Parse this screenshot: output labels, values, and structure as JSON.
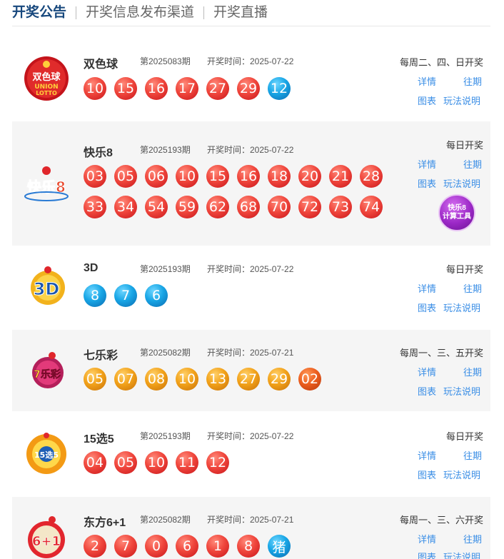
{
  "tabs": [
    "开奖公告",
    "开奖信息发布渠道",
    "开奖直播"
  ],
  "links": {
    "detail": "详情",
    "past": "往期",
    "chart": "图表",
    "howto": "玩法说明"
  },
  "colors": {
    "red": "#e83a32",
    "blue": "#1296db",
    "orange": "#f2a21a",
    "dark_orange": "#ec5e1f",
    "link": "#3a8ee6",
    "active_tab": "#17487d",
    "row_gray": "#f5f5f5"
  },
  "lotteries": [
    {
      "name": "双色球",
      "issue": "第2025083期",
      "date": "开奖时间：2025-07-22",
      "schedule": "每周二、四、日开奖",
      "logo_icon": "ssq-logo-icon",
      "logo_text": "双色球",
      "balls": [
        {
          "n": "10",
          "c": "red"
        },
        {
          "n": "15",
          "c": "red"
        },
        {
          "n": "16",
          "c": "red"
        },
        {
          "n": "17",
          "c": "red"
        },
        {
          "n": "27",
          "c": "red"
        },
        {
          "n": "29",
          "c": "red"
        },
        {
          "n": "12",
          "c": "blue"
        }
      ]
    },
    {
      "name": "快乐8",
      "issue": "第2025193期",
      "date": "开奖时间：2025-07-22",
      "schedule": "每日开奖",
      "logo_icon": "kl8-logo-icon",
      "logo_text": "快乐8",
      "tool_label": [
        "快乐8",
        "计算工具"
      ],
      "balls": [
        {
          "n": "03",
          "c": "red"
        },
        {
          "n": "05",
          "c": "red"
        },
        {
          "n": "06",
          "c": "red"
        },
        {
          "n": "10",
          "c": "red"
        },
        {
          "n": "15",
          "c": "red"
        },
        {
          "n": "16",
          "c": "red"
        },
        {
          "n": "18",
          "c": "red"
        },
        {
          "n": "20",
          "c": "red"
        },
        {
          "n": "21",
          "c": "red"
        },
        {
          "n": "28",
          "c": "red"
        },
        {
          "n": "33",
          "c": "red"
        },
        {
          "n": "34",
          "c": "red"
        },
        {
          "n": "54",
          "c": "red"
        },
        {
          "n": "59",
          "c": "red"
        },
        {
          "n": "62",
          "c": "red"
        },
        {
          "n": "68",
          "c": "red"
        },
        {
          "n": "70",
          "c": "red"
        },
        {
          "n": "72",
          "c": "red"
        },
        {
          "n": "73",
          "c": "red"
        },
        {
          "n": "74",
          "c": "red"
        }
      ]
    },
    {
      "name": "3D",
      "issue": "第2025193期",
      "date": "开奖时间：2025-07-22",
      "schedule": "每日开奖",
      "logo_icon": "3d-logo-icon",
      "logo_text": "3D",
      "balls": [
        {
          "n": "8",
          "c": "blue"
        },
        {
          "n": "7",
          "c": "blue"
        },
        {
          "n": "6",
          "c": "blue"
        }
      ]
    },
    {
      "name": "七乐彩",
      "issue": "第2025082期",
      "date": "开奖时间：2025-07-21",
      "schedule": "每周一、三、五开奖",
      "logo_icon": "qlc-logo-icon",
      "logo_text": "7乐彩",
      "balls": [
        {
          "n": "05",
          "c": "orange"
        },
        {
          "n": "07",
          "c": "orange"
        },
        {
          "n": "08",
          "c": "orange"
        },
        {
          "n": "10",
          "c": "orange"
        },
        {
          "n": "13",
          "c": "orange"
        },
        {
          "n": "27",
          "c": "orange"
        },
        {
          "n": "29",
          "c": "orange"
        },
        {
          "n": "02",
          "c": "dorange"
        }
      ]
    },
    {
      "name": "15选5",
      "issue": "第2025193期",
      "date": "开奖时间：2025-07-22",
      "schedule": "每日开奖",
      "logo_icon": "15x5-logo-icon",
      "logo_text": "15选5",
      "balls": [
        {
          "n": "04",
          "c": "red"
        },
        {
          "n": "05",
          "c": "red"
        },
        {
          "n": "10",
          "c": "red"
        },
        {
          "n": "11",
          "c": "red"
        },
        {
          "n": "12",
          "c": "red"
        }
      ]
    },
    {
      "name": "东方6+1",
      "issue": "第2025082期",
      "date": "开奖时间：2025-07-21",
      "schedule": "每周一、三、六开奖",
      "logo_icon": "df61-logo-icon",
      "logo_text": "6+1",
      "balls": [
        {
          "n": "2",
          "c": "red"
        },
        {
          "n": "7",
          "c": "red"
        },
        {
          "n": "0",
          "c": "red"
        },
        {
          "n": "6",
          "c": "red"
        },
        {
          "n": "1",
          "c": "red"
        },
        {
          "n": "8",
          "c": "red"
        },
        {
          "n": "猪",
          "c": "blue"
        }
      ]
    }
  ]
}
